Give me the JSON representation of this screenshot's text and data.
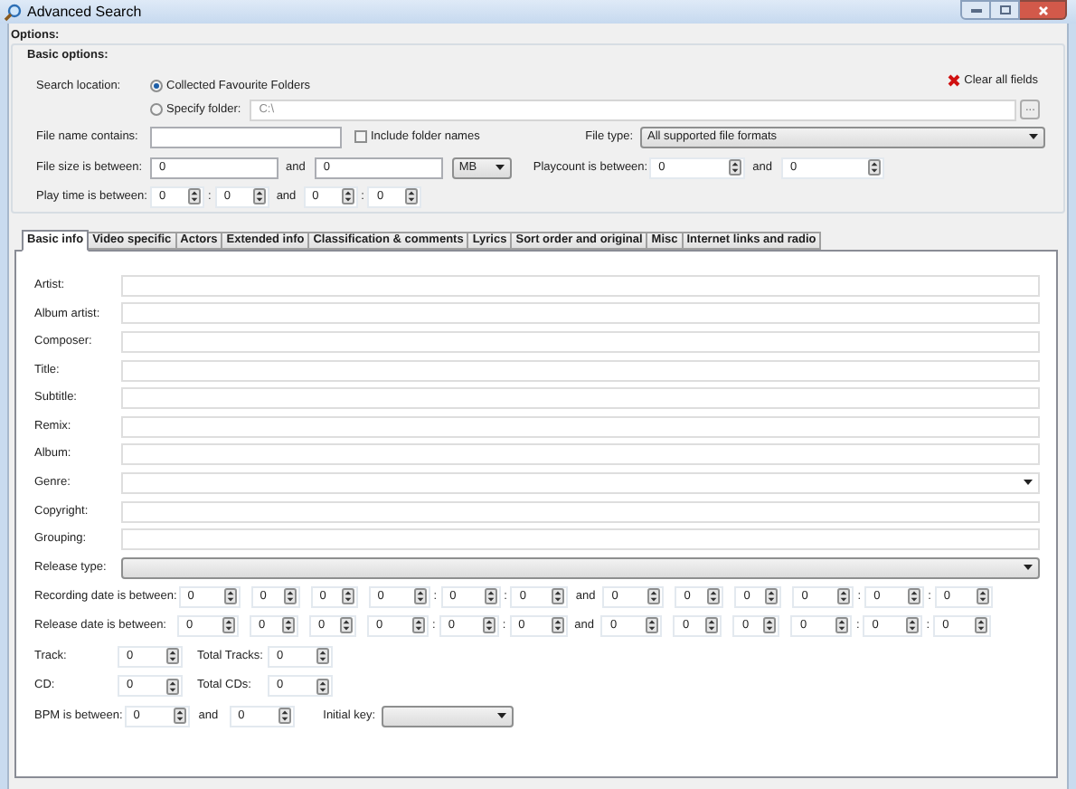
{
  "window": {
    "title": "Advanced Search"
  },
  "options_heading": "Options:",
  "basic_options": {
    "title": "Basic options:",
    "search_location": {
      "label": "Search location:",
      "choices": [
        {
          "label": "Collected Favourite Folders",
          "selected": true
        },
        {
          "label": "Specify folder:",
          "selected": false,
          "value": "C:\\",
          "disabled": true,
          "browse": "..."
        }
      ]
    },
    "clear_all": "Clear all fields",
    "file_name": {
      "label": "File name contains:",
      "include_folder_names": {
        "label": "Include folder names",
        "checked": false
      }
    },
    "file_type": {
      "label": "File type:",
      "value": "All supported file formats"
    },
    "file_size": {
      "label": "File size is between:",
      "from": "0",
      "and": "and",
      "to": "0",
      "unit": "MB"
    },
    "playcount": {
      "label": "Playcount is between:",
      "from": "0",
      "and": "and",
      "to": "0"
    },
    "play_time": {
      "label": "Play time is between:",
      "items": [
        {
          "kind": "spin",
          "value": "0"
        },
        {
          "kind": "sep",
          "text": ":"
        },
        {
          "kind": "spin",
          "value": "0"
        },
        {
          "kind": "and",
          "text": "and"
        },
        {
          "kind": "spin",
          "value": "0"
        },
        {
          "kind": "sep",
          "text": ":"
        },
        {
          "kind": "spin",
          "value": "0"
        }
      ]
    }
  },
  "tabs": [
    {
      "label": "Basic info",
      "selected": true
    },
    {
      "label": "Video specific",
      "selected": false
    },
    {
      "label": "Actors",
      "selected": false
    },
    {
      "label": "Extended info",
      "selected": false
    },
    {
      "label": "Classification & comments",
      "selected": false
    },
    {
      "label": "Lyrics",
      "selected": false
    },
    {
      "label": "Sort order and original",
      "selected": false
    },
    {
      "label": "Misc",
      "selected": false
    },
    {
      "label": "Internet links and radio",
      "selected": false
    }
  ],
  "fields": [
    {
      "label": "Artist:",
      "kind": "text"
    },
    {
      "label": "Album artist:",
      "kind": "text"
    },
    {
      "label": "Composer:",
      "kind": "text"
    },
    {
      "label": "Title:",
      "kind": "text"
    },
    {
      "label": "Subtitle:",
      "kind": "text"
    },
    {
      "label": "Remix:",
      "kind": "text"
    },
    {
      "label": "Album:",
      "kind": "text"
    },
    {
      "label": "Genre:",
      "kind": "combo"
    },
    {
      "label": "Copyright:",
      "kind": "text"
    },
    {
      "label": "Grouping:",
      "kind": "text"
    },
    {
      "label": "Release type:",
      "kind": "select"
    }
  ],
  "date_rows": [
    {
      "label": "Recording date is between:",
      "items": [
        {
          "kind": "spin",
          "value": "0"
        },
        {
          "kind": "spin",
          "value": "0"
        },
        {
          "kind": "spin",
          "value": "0"
        },
        {
          "kind": "spin",
          "value": "0"
        },
        {
          "kind": "sep",
          "text": ":"
        },
        {
          "kind": "spin",
          "value": "0"
        },
        {
          "kind": "sep",
          "text": ":"
        },
        {
          "kind": "spin",
          "value": "0"
        },
        {
          "kind": "and",
          "text": "and"
        },
        {
          "kind": "spin",
          "value": "0"
        },
        {
          "kind": "spin",
          "value": "0"
        },
        {
          "kind": "spin",
          "value": "0"
        },
        {
          "kind": "spin",
          "value": "0"
        },
        {
          "kind": "sep",
          "text": ":"
        },
        {
          "kind": "spin",
          "value": "0"
        },
        {
          "kind": "sep",
          "text": ":"
        },
        {
          "kind": "spin",
          "value": "0"
        }
      ]
    },
    {
      "label": "Release date is between:",
      "items": [
        {
          "kind": "spin",
          "value": "0"
        },
        {
          "kind": "spin",
          "value": "0"
        },
        {
          "kind": "spin",
          "value": "0"
        },
        {
          "kind": "spin",
          "value": "0"
        },
        {
          "kind": "sep",
          "text": ":"
        },
        {
          "kind": "spin",
          "value": "0"
        },
        {
          "kind": "sep",
          "text": ":"
        },
        {
          "kind": "spin",
          "value": "0"
        },
        {
          "kind": "and",
          "text": "and"
        },
        {
          "kind": "spin",
          "value": "0"
        },
        {
          "kind": "spin",
          "value": "0"
        },
        {
          "kind": "spin",
          "value": "0"
        },
        {
          "kind": "spin",
          "value": "0"
        },
        {
          "kind": "sep",
          "text": ":"
        },
        {
          "kind": "spin",
          "value": "0"
        },
        {
          "kind": "sep",
          "text": ":"
        },
        {
          "kind": "spin",
          "value": "0"
        }
      ]
    }
  ],
  "track": {
    "label": "Track:",
    "value": "0",
    "total_label": "Total Tracks:",
    "total": "0"
  },
  "cd": {
    "label": "CD:",
    "value": "0",
    "total_label": "Total CDs:",
    "total": "0"
  },
  "bpm": {
    "label": "BPM is between:",
    "from": "0",
    "and": "and",
    "to": "0",
    "initial_key_label": "Initial key:"
  }
}
